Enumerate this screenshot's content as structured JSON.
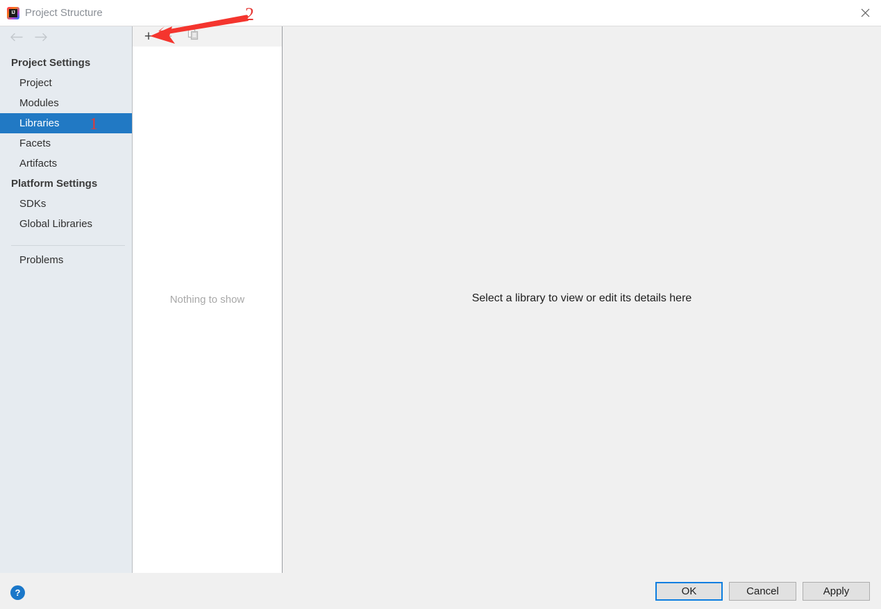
{
  "window": {
    "title": "Project Structure",
    "logo_icon": "intellij-idea-logo",
    "close_icon": "close-icon"
  },
  "sidebar": {
    "nav": {
      "back_icon": "arrow-left-icon",
      "forward_icon": "arrow-right-icon"
    },
    "groups": [
      {
        "header": "Project Settings",
        "items": [
          "Project",
          "Modules",
          "Libraries",
          "Facets",
          "Artifacts"
        ]
      },
      {
        "header": "Platform Settings",
        "items": [
          "SDKs",
          "Global Libraries"
        ]
      }
    ],
    "footer_items": [
      "Problems"
    ],
    "selected_item": "Libraries",
    "selection_color": "#2179c4"
  },
  "middle_panel": {
    "toolbar": {
      "add_label": "+",
      "add_icon": "plus-icon",
      "remove_label": "−",
      "remove_icon": "minus-icon",
      "copy_icon": "copy-icon"
    },
    "empty_text": "Nothing to show"
  },
  "main_panel": {
    "message": "Select a library to view or edit its details here"
  },
  "bottom_bar": {
    "help_icon": "help-icon",
    "help_label": "?",
    "buttons": [
      {
        "label": "OK",
        "default": true
      },
      {
        "label": "Cancel",
        "default": false
      },
      {
        "label": "Apply",
        "default": false
      }
    ]
  },
  "annotations": {
    "color": "#e53935",
    "marker_1": "1",
    "marker_2": "2",
    "arrow_icon": "red-arrow-icon"
  }
}
